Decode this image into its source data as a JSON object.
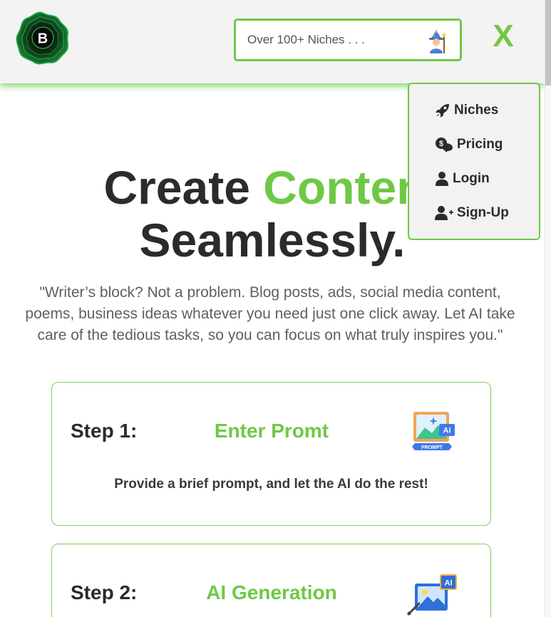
{
  "header": {
    "logo_letter": "B",
    "search": {
      "placeholder": "Over 100+ Niches . . .",
      "value": ""
    },
    "close_label": "X"
  },
  "menu": {
    "items": [
      {
        "label": "Niches",
        "icon": "rocket-icon"
      },
      {
        "label": "Pricing",
        "icon": "coins-chat-icon"
      },
      {
        "label": "Login",
        "icon": "user-icon"
      },
      {
        "label": "Sign-Up",
        "icon": "user-plus-icon"
      }
    ]
  },
  "hero": {
    "title_part1": "Create",
    "title_accent": "Content",
    "title_part2": "Seamlessly.",
    "description_lines": [
      "\"Writer’s block? Not a problem. Blog posts, ads, social media content,",
      "poems, business ideas whatever you need just one click away. Let AI take",
      "care of the tedious tasks, so you can focus on what truly inspires you.\""
    ]
  },
  "steps": [
    {
      "label": "Step 1:",
      "title": "Enter Promt",
      "description": "Provide a brief prompt, and let the AI do the rest!",
      "icon": "ai-prompt-image-icon",
      "icon_text_ai": "AI",
      "icon_text_prompt": "PROMPT"
    },
    {
      "label": "Step 2:",
      "title": "AI Generation",
      "description": "",
      "icon": "ai-generation-image-icon",
      "icon_text_ai": "AI"
    }
  ],
  "colors": {
    "accent": "#6fc845",
    "text_dark": "#2b2b2b",
    "text_muted": "#5f5f5f",
    "header_bg": "#f3f3f3"
  }
}
